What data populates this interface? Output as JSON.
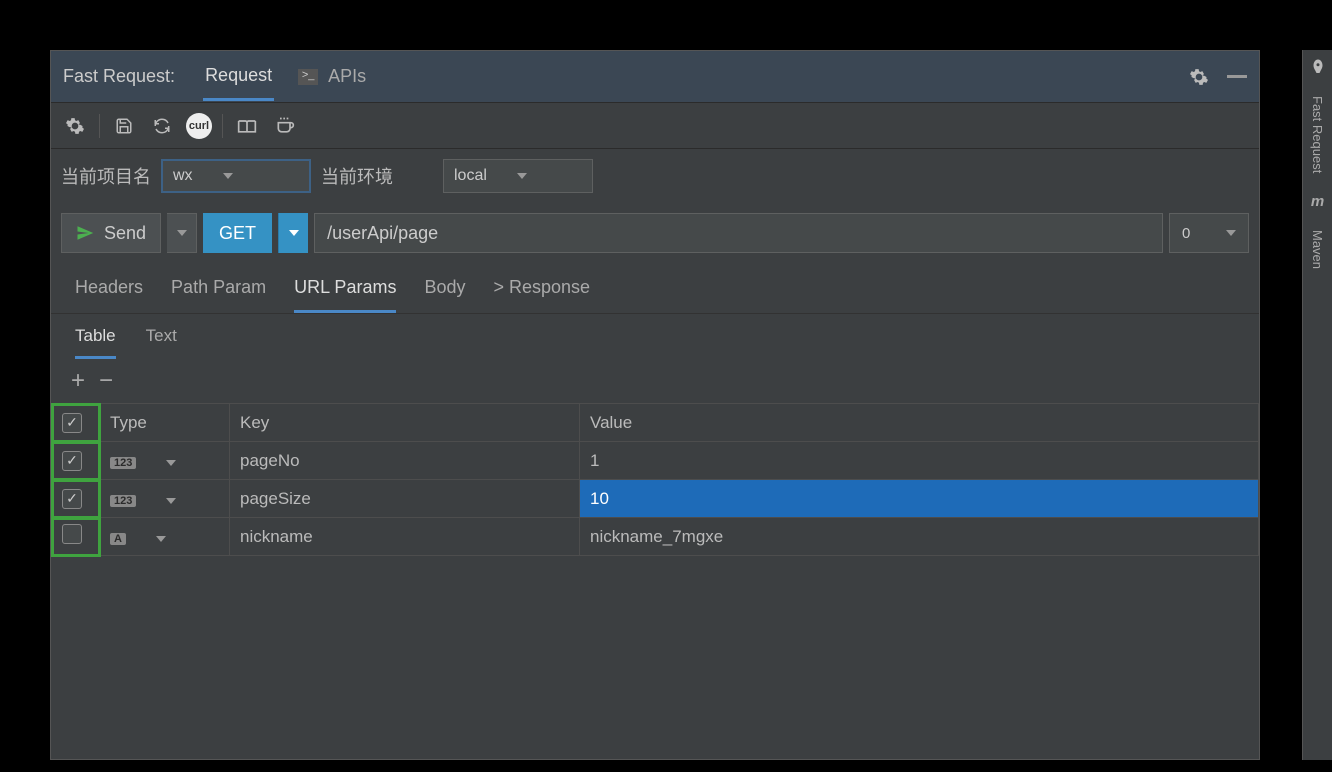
{
  "panel_title": "Fast Request:",
  "top_tabs": [
    "Request",
    "APIs"
  ],
  "active_top_tab": 0,
  "project_label": "当前项目名",
  "project_value": "wx",
  "env_label": "当前环境",
  "env_value": "local",
  "send_label": "Send",
  "method": "GET",
  "url": "/userApi/page",
  "count": "0",
  "req_tabs": [
    "Headers",
    "Path Param",
    "URL Params",
    "Body",
    "> Response"
  ],
  "active_req_tab": 2,
  "view_tabs": [
    "Table",
    "Text"
  ],
  "active_view_tab": 0,
  "columns": {
    "check": "",
    "type": "Type",
    "key": "Key",
    "value": "Value"
  },
  "rows": [
    {
      "checked": true,
      "type_icon": "123",
      "key": "pageNo",
      "value": "1",
      "selected": false
    },
    {
      "checked": true,
      "type_icon": "123",
      "key": "pageSize",
      "value": "10",
      "selected": true
    },
    {
      "checked": false,
      "type_icon": "A",
      "key": "nickname",
      "value": "nickname_7mgxe",
      "selected": false
    }
  ],
  "side_tabs": [
    "Fast Request",
    "Maven"
  ]
}
